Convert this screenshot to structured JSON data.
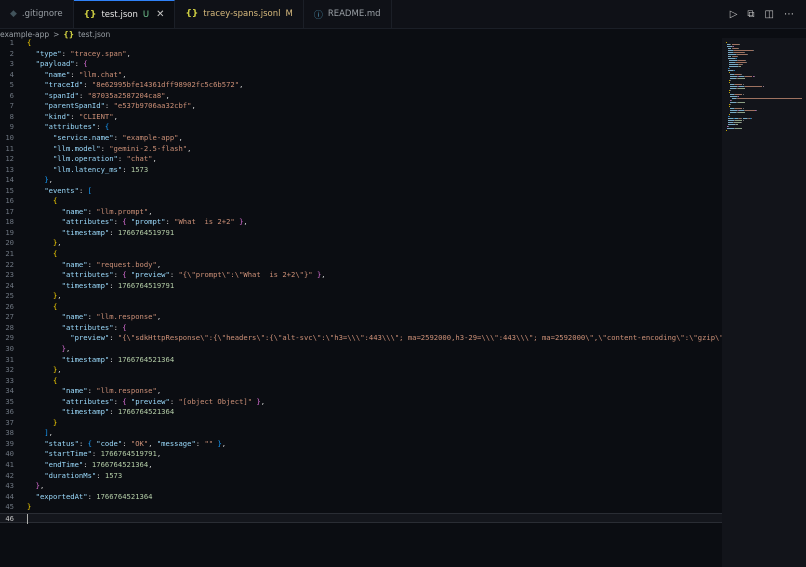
{
  "tabs": [
    {
      "icon": "git-icon",
      "label": ".gitignore",
      "badge": "",
      "active": false
    },
    {
      "icon": "json-icon",
      "label": "test.json",
      "badge": "U",
      "active": true
    },
    {
      "icon": "json-icon",
      "label": "tracey-spans.jsonl",
      "badge": "M",
      "active": false
    },
    {
      "icon": "info-icon",
      "label": "README.md",
      "badge": "",
      "active": false
    }
  ],
  "tab_actions": [
    "run-icon",
    "split-compare-icon",
    "split-editor-icon",
    "more-icon"
  ],
  "breadcrumb": {
    "folder": "example-app",
    "separator": ">",
    "file": "test.json"
  },
  "colors": {
    "key": "#9cdcfe",
    "string": "#ce9178",
    "number": "#b5cea8",
    "brace1": "#ffd700",
    "brace2": "#da70d6",
    "brace3": "#179fff"
  },
  "editor": {
    "current_line": 46,
    "lines": [
      [
        [
          "b1",
          "{"
        ]
      ],
      [
        [
          "p",
          "  "
        ],
        [
          "k",
          "\"type\""
        ],
        [
          "p",
          ": "
        ],
        [
          "s",
          "\"tracey.span\""
        ],
        [
          "p",
          ","
        ]
      ],
      [
        [
          "p",
          "  "
        ],
        [
          "k",
          "\"payload\""
        ],
        [
          "p",
          ": "
        ],
        [
          "b2",
          "{"
        ]
      ],
      [
        [
          "p",
          "    "
        ],
        [
          "k",
          "\"name\""
        ],
        [
          "p",
          ": "
        ],
        [
          "s",
          "\"llm.chat\""
        ],
        [
          "p",
          ","
        ]
      ],
      [
        [
          "p",
          "    "
        ],
        [
          "k",
          "\"traceId\""
        ],
        [
          "p",
          ": "
        ],
        [
          "s",
          "\"8e62995bfe14361dff98902fc5c6b572\""
        ],
        [
          "p",
          ","
        ]
      ],
      [
        [
          "p",
          "    "
        ],
        [
          "k",
          "\"spanId\""
        ],
        [
          "p",
          ": "
        ],
        [
          "s",
          "\"87035a2587204ca8\""
        ],
        [
          "p",
          ","
        ]
      ],
      [
        [
          "p",
          "    "
        ],
        [
          "k",
          "\"parentSpanId\""
        ],
        [
          "p",
          ": "
        ],
        [
          "s",
          "\"e537b9706aa32cbf\""
        ],
        [
          "p",
          ","
        ]
      ],
      [
        [
          "p",
          "    "
        ],
        [
          "k",
          "\"kind\""
        ],
        [
          "p",
          ": "
        ],
        [
          "s",
          "\"CLIENT\""
        ],
        [
          "p",
          ","
        ]
      ],
      [
        [
          "p",
          "    "
        ],
        [
          "k",
          "\"attributes\""
        ],
        [
          "p",
          ": "
        ],
        [
          "b3",
          "{"
        ]
      ],
      [
        [
          "p",
          "      "
        ],
        [
          "k",
          "\"service.name\""
        ],
        [
          "p",
          ": "
        ],
        [
          "s",
          "\"example-app\""
        ],
        [
          "p",
          ","
        ]
      ],
      [
        [
          "p",
          "      "
        ],
        [
          "k",
          "\"llm.model\""
        ],
        [
          "p",
          ": "
        ],
        [
          "s",
          "\"gemini-2.5-flash\""
        ],
        [
          "p",
          ","
        ]
      ],
      [
        [
          "p",
          "      "
        ],
        [
          "k",
          "\"llm.operation\""
        ],
        [
          "p",
          ": "
        ],
        [
          "s",
          "\"chat\""
        ],
        [
          "p",
          ","
        ]
      ],
      [
        [
          "p",
          "      "
        ],
        [
          "k",
          "\"llm.latency_ms\""
        ],
        [
          "p",
          ": "
        ],
        [
          "n",
          "1573"
        ]
      ],
      [
        [
          "p",
          "    "
        ],
        [
          "b3",
          "}"
        ],
        [
          "p",
          ","
        ]
      ],
      [
        [
          "p",
          "    "
        ],
        [
          "k",
          "\"events\""
        ],
        [
          "p",
          ": "
        ],
        [
          "b3",
          "["
        ]
      ],
      [
        [
          "p",
          "      "
        ],
        [
          "b1",
          "{"
        ]
      ],
      [
        [
          "p",
          "        "
        ],
        [
          "k",
          "\"name\""
        ],
        [
          "p",
          ": "
        ],
        [
          "s",
          "\"llm.prompt\""
        ],
        [
          "p",
          ","
        ]
      ],
      [
        [
          "p",
          "        "
        ],
        [
          "k",
          "\"attributes\""
        ],
        [
          "p",
          ": "
        ],
        [
          "b2",
          "{"
        ],
        [
          "p",
          " "
        ],
        [
          "k",
          "\"prompt\""
        ],
        [
          "p",
          ": "
        ],
        [
          "s",
          "\"What  is 2+2\""
        ],
        [
          "p",
          " "
        ],
        [
          "b2",
          "}"
        ],
        [
          "p",
          ","
        ]
      ],
      [
        [
          "p",
          "        "
        ],
        [
          "k",
          "\"timestamp\""
        ],
        [
          "p",
          ": "
        ],
        [
          "n",
          "1766764519791"
        ]
      ],
      [
        [
          "p",
          "      "
        ],
        [
          "b1",
          "}"
        ],
        [
          "p",
          ","
        ]
      ],
      [
        [
          "p",
          "      "
        ],
        [
          "b1",
          "{"
        ]
      ],
      [
        [
          "p",
          "        "
        ],
        [
          "k",
          "\"name\""
        ],
        [
          "p",
          ": "
        ],
        [
          "s",
          "\"request.body\""
        ],
        [
          "p",
          ","
        ]
      ],
      [
        [
          "p",
          "        "
        ],
        [
          "k",
          "\"attributes\""
        ],
        [
          "p",
          ": "
        ],
        [
          "b2",
          "{"
        ],
        [
          "p",
          " "
        ],
        [
          "k",
          "\"preview\""
        ],
        [
          "p",
          ": "
        ],
        [
          "s",
          "\"{\\\"prompt\\\":\\\"What  is 2+2\\\"}\""
        ],
        [
          "p",
          " "
        ],
        [
          "b2",
          "}"
        ],
        [
          "p",
          ","
        ]
      ],
      [
        [
          "p",
          "        "
        ],
        [
          "k",
          "\"timestamp\""
        ],
        [
          "p",
          ": "
        ],
        [
          "n",
          "1766764519791"
        ]
      ],
      [
        [
          "p",
          "      "
        ],
        [
          "b1",
          "}"
        ],
        [
          "p",
          ","
        ]
      ],
      [
        [
          "p",
          "      "
        ],
        [
          "b1",
          "{"
        ]
      ],
      [
        [
          "p",
          "        "
        ],
        [
          "k",
          "\"name\""
        ],
        [
          "p",
          ": "
        ],
        [
          "s",
          "\"llm.response\""
        ],
        [
          "p",
          ","
        ]
      ],
      [
        [
          "p",
          "        "
        ],
        [
          "k",
          "\"attributes\""
        ],
        [
          "p",
          ": "
        ],
        [
          "b2",
          "{"
        ]
      ],
      [
        [
          "p",
          "          "
        ],
        [
          "k",
          "\"preview\""
        ],
        [
          "p",
          ": "
        ],
        [
          "s",
          "\"{\\\"sdkHttpResponse\\\":{\\\"headers\\\":{\\\"alt-svc\\\":\\\"h3=\\\\\\\":443\\\\\\\"; ma=2592000,h3-29=\\\\\\\":443\\\\\\\"; ma=2592000\\\",\\\"content-encoding\\\":\\\"gzip\\\",\\\"content-type\\\":"
        ]
      ],
      [
        [
          "p",
          "        "
        ],
        [
          "b2",
          "}"
        ],
        [
          "p",
          ","
        ]
      ],
      [
        [
          "p",
          "        "
        ],
        [
          "k",
          "\"timestamp\""
        ],
        [
          "p",
          ": "
        ],
        [
          "n",
          "1766764521364"
        ]
      ],
      [
        [
          "p",
          "      "
        ],
        [
          "b1",
          "}"
        ],
        [
          "p",
          ","
        ]
      ],
      [
        [
          "p",
          "      "
        ],
        [
          "b1",
          "{"
        ]
      ],
      [
        [
          "p",
          "        "
        ],
        [
          "k",
          "\"name\""
        ],
        [
          "p",
          ": "
        ],
        [
          "s",
          "\"llm.response\""
        ],
        [
          "p",
          ","
        ]
      ],
      [
        [
          "p",
          "        "
        ],
        [
          "k",
          "\"attributes\""
        ],
        [
          "p",
          ": "
        ],
        [
          "b2",
          "{"
        ],
        [
          "p",
          " "
        ],
        [
          "k",
          "\"preview\""
        ],
        [
          "p",
          ": "
        ],
        [
          "s",
          "\"[object Object]\""
        ],
        [
          "p",
          " "
        ],
        [
          "b2",
          "}"
        ],
        [
          "p",
          ","
        ]
      ],
      [
        [
          "p",
          "        "
        ],
        [
          "k",
          "\"timestamp\""
        ],
        [
          "p",
          ": "
        ],
        [
          "n",
          "1766764521364"
        ]
      ],
      [
        [
          "p",
          "      "
        ],
        [
          "b1",
          "}"
        ]
      ],
      [
        [
          "p",
          "    "
        ],
        [
          "b3",
          "]"
        ],
        [
          "p",
          ","
        ]
      ],
      [
        [
          "p",
          "    "
        ],
        [
          "k",
          "\"status\""
        ],
        [
          "p",
          ": "
        ],
        [
          "b3",
          "{"
        ],
        [
          "p",
          " "
        ],
        [
          "k",
          "\"code\""
        ],
        [
          "p",
          ": "
        ],
        [
          "s",
          "\"OK\""
        ],
        [
          "p",
          ", "
        ],
        [
          "k",
          "\"message\""
        ],
        [
          "p",
          ": "
        ],
        [
          "s",
          "\"\""
        ],
        [
          "p",
          " "
        ],
        [
          "b3",
          "}"
        ],
        [
          "p",
          ","
        ]
      ],
      [
        [
          "p",
          "    "
        ],
        [
          "k",
          "\"startTime\""
        ],
        [
          "p",
          ": "
        ],
        [
          "n",
          "1766764519791"
        ],
        [
          "p",
          ","
        ]
      ],
      [
        [
          "p",
          "    "
        ],
        [
          "k",
          "\"endTime\""
        ],
        [
          "p",
          ": "
        ],
        [
          "n",
          "1766764521364"
        ],
        [
          "p",
          ","
        ]
      ],
      [
        [
          "p",
          "    "
        ],
        [
          "k",
          "\"durationMs\""
        ],
        [
          "p",
          ": "
        ],
        [
          "n",
          "1573"
        ]
      ],
      [
        [
          "p",
          "  "
        ],
        [
          "b2",
          "}"
        ],
        [
          "p",
          ","
        ]
      ],
      [
        [
          "p",
          "  "
        ],
        [
          "k",
          "\"exportedAt\""
        ],
        [
          "p",
          ": "
        ],
        [
          "n",
          "1766764521364"
        ]
      ],
      [
        [
          "b1",
          "}"
        ]
      ],
      [
        [
          "p",
          ""
        ]
      ]
    ]
  }
}
